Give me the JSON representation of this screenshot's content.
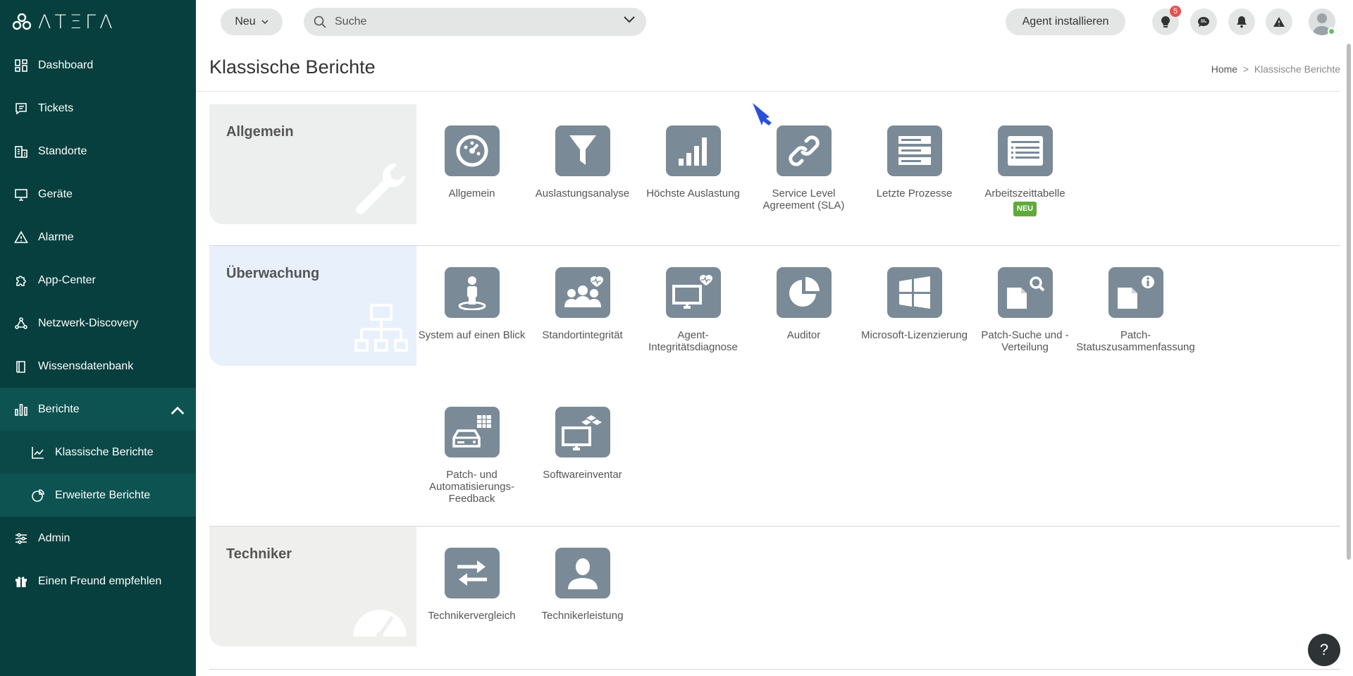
{
  "brand": {
    "logo_text": "ΛΤΞΓΛ"
  },
  "sidebar": {
    "items": [
      {
        "label": "Dashboard",
        "icon": "dashboard-icon"
      },
      {
        "label": "Tickets",
        "icon": "ticket-icon"
      },
      {
        "label": "Standorte",
        "icon": "building-icon"
      },
      {
        "label": "Geräte",
        "icon": "monitor-icon"
      },
      {
        "label": "Alarme",
        "icon": "alert-icon"
      },
      {
        "label": "App-Center",
        "icon": "puzzle-icon"
      },
      {
        "label": "Netzwerk-Discovery",
        "icon": "network-icon"
      },
      {
        "label": "Wissensdatenbank",
        "icon": "book-icon"
      },
      {
        "label": "Berichte",
        "icon": "chart-icon"
      }
    ],
    "sub_items": [
      {
        "label": "Klassische Berichte",
        "icon": "line-chart-icon"
      },
      {
        "label": "Erweiterte Berichte",
        "icon": "pie-chart-icon"
      }
    ],
    "bottom_items": [
      {
        "label": "Admin",
        "icon": "sliders-icon"
      },
      {
        "label": "Einen Freund empfehlen",
        "icon": "gift-icon"
      }
    ]
  },
  "topbar": {
    "new_label": "Neu",
    "search_placeholder": "Suche",
    "agent_label": "Agent installieren",
    "notif_count": "5"
  },
  "page": {
    "title": "Klassische Berichte",
    "breadcrumb_home": "Home",
    "breadcrumb_sep": ">",
    "breadcrumb_current": "Klassische Berichte"
  },
  "sections": [
    {
      "title": "Allgemein",
      "tiles": [
        {
          "label": "Allgemein",
          "icon": "gauge-icon"
        },
        {
          "label": "Auslastungsanalyse",
          "icon": "funnel-icon"
        },
        {
          "label": "Höchste Auslastung",
          "icon": "bars-icon"
        },
        {
          "label": "Service Level Agreement (SLA)",
          "icon": "link-icon"
        },
        {
          "label": "Letzte Prozesse",
          "icon": "server-icon"
        },
        {
          "label": "Arbeitszeittabelle",
          "icon": "list-icon",
          "badge": "NEU"
        }
      ]
    },
    {
      "title": "Überwachung",
      "tiles": [
        {
          "label": "System auf einen Blick",
          "icon": "person-pin-icon"
        },
        {
          "label": "Standortintegrität",
          "icon": "group-heart-icon"
        },
        {
          "label": "Agent-Integritätsdiagnose",
          "icon": "monitor-heart-icon"
        },
        {
          "label": "Auditor",
          "icon": "pie-icon"
        },
        {
          "label": "Microsoft-Lizenzierung",
          "icon": "windows-icon"
        },
        {
          "label": "Patch-Suche und -Verteilung",
          "icon": "doc-search-icon"
        },
        {
          "label": "Patch-Statuszusammenfassung",
          "icon": "doc-info-icon"
        },
        {
          "label": "Patch- und Automatisierungs-Feedback",
          "icon": "drive-grid-icon"
        },
        {
          "label": "Softwareinventar",
          "icon": "monitor-boxes-icon"
        }
      ]
    },
    {
      "title": "Techniker",
      "tiles": [
        {
          "label": "Technikervergleich",
          "icon": "swap-icon"
        },
        {
          "label": "Technikerleistung",
          "icon": "user-icon"
        }
      ]
    }
  ],
  "help_label": "?"
}
